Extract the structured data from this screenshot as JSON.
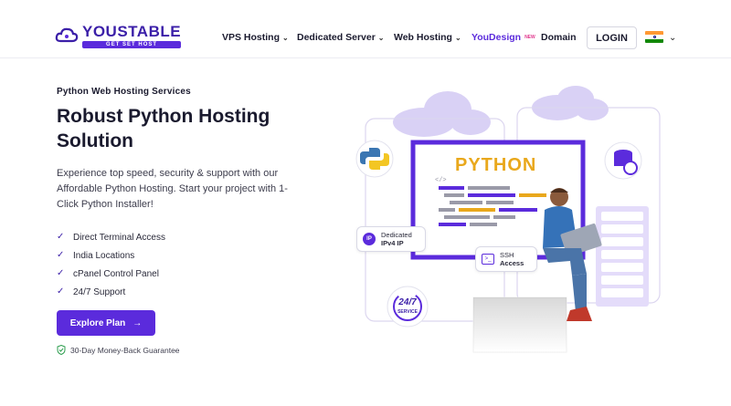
{
  "header": {
    "logo": {
      "name": "YOUSTABLE",
      "tagline": "GET SET HOST"
    },
    "nav": [
      {
        "label": "VPS Hosting",
        "has_dropdown": true
      },
      {
        "label": "Dedicated Server",
        "has_dropdown": true
      },
      {
        "label": "Web Hosting",
        "has_dropdown": true
      },
      {
        "label": "YouDesign",
        "badge": "NEW",
        "has_dropdown": false
      },
      {
        "label": "Domain",
        "has_dropdown": false
      }
    ],
    "login_label": "LOGIN",
    "flag_icon": "india-flag-icon"
  },
  "hero": {
    "eyebrow": "Python Web Hosting Services",
    "title": "Robust Python Hosting Solution",
    "description": "Experience top speed, security & support with our Affordable Python Hosting. Start your project with 1-Click Python Installer!",
    "features": [
      "Direct Terminal Access",
      "India Locations",
      "cPanel Control Panel",
      "24/7 Support"
    ],
    "cta_label": "Explore Plan",
    "cta_arrow": "→",
    "guarantee": "30-Day Money-Back Guarantee"
  },
  "illustration": {
    "screen_title": "PYTHON",
    "code_tag": "</>",
    "ip_badge": {
      "line1": "Dedicated",
      "line2": "IPv4 IP",
      "icon_text": "IP"
    },
    "ssh_badge": {
      "line1": "SSH",
      "line2": "Access"
    },
    "support_badge": {
      "line1": "24/7",
      "line2": "SERVICE"
    }
  },
  "colors": {
    "brand": "#5b2bdc",
    "brand_dark": "#3b1fa8",
    "python_yellow": "#e9a81c",
    "cloud": "#d9d1f5"
  }
}
